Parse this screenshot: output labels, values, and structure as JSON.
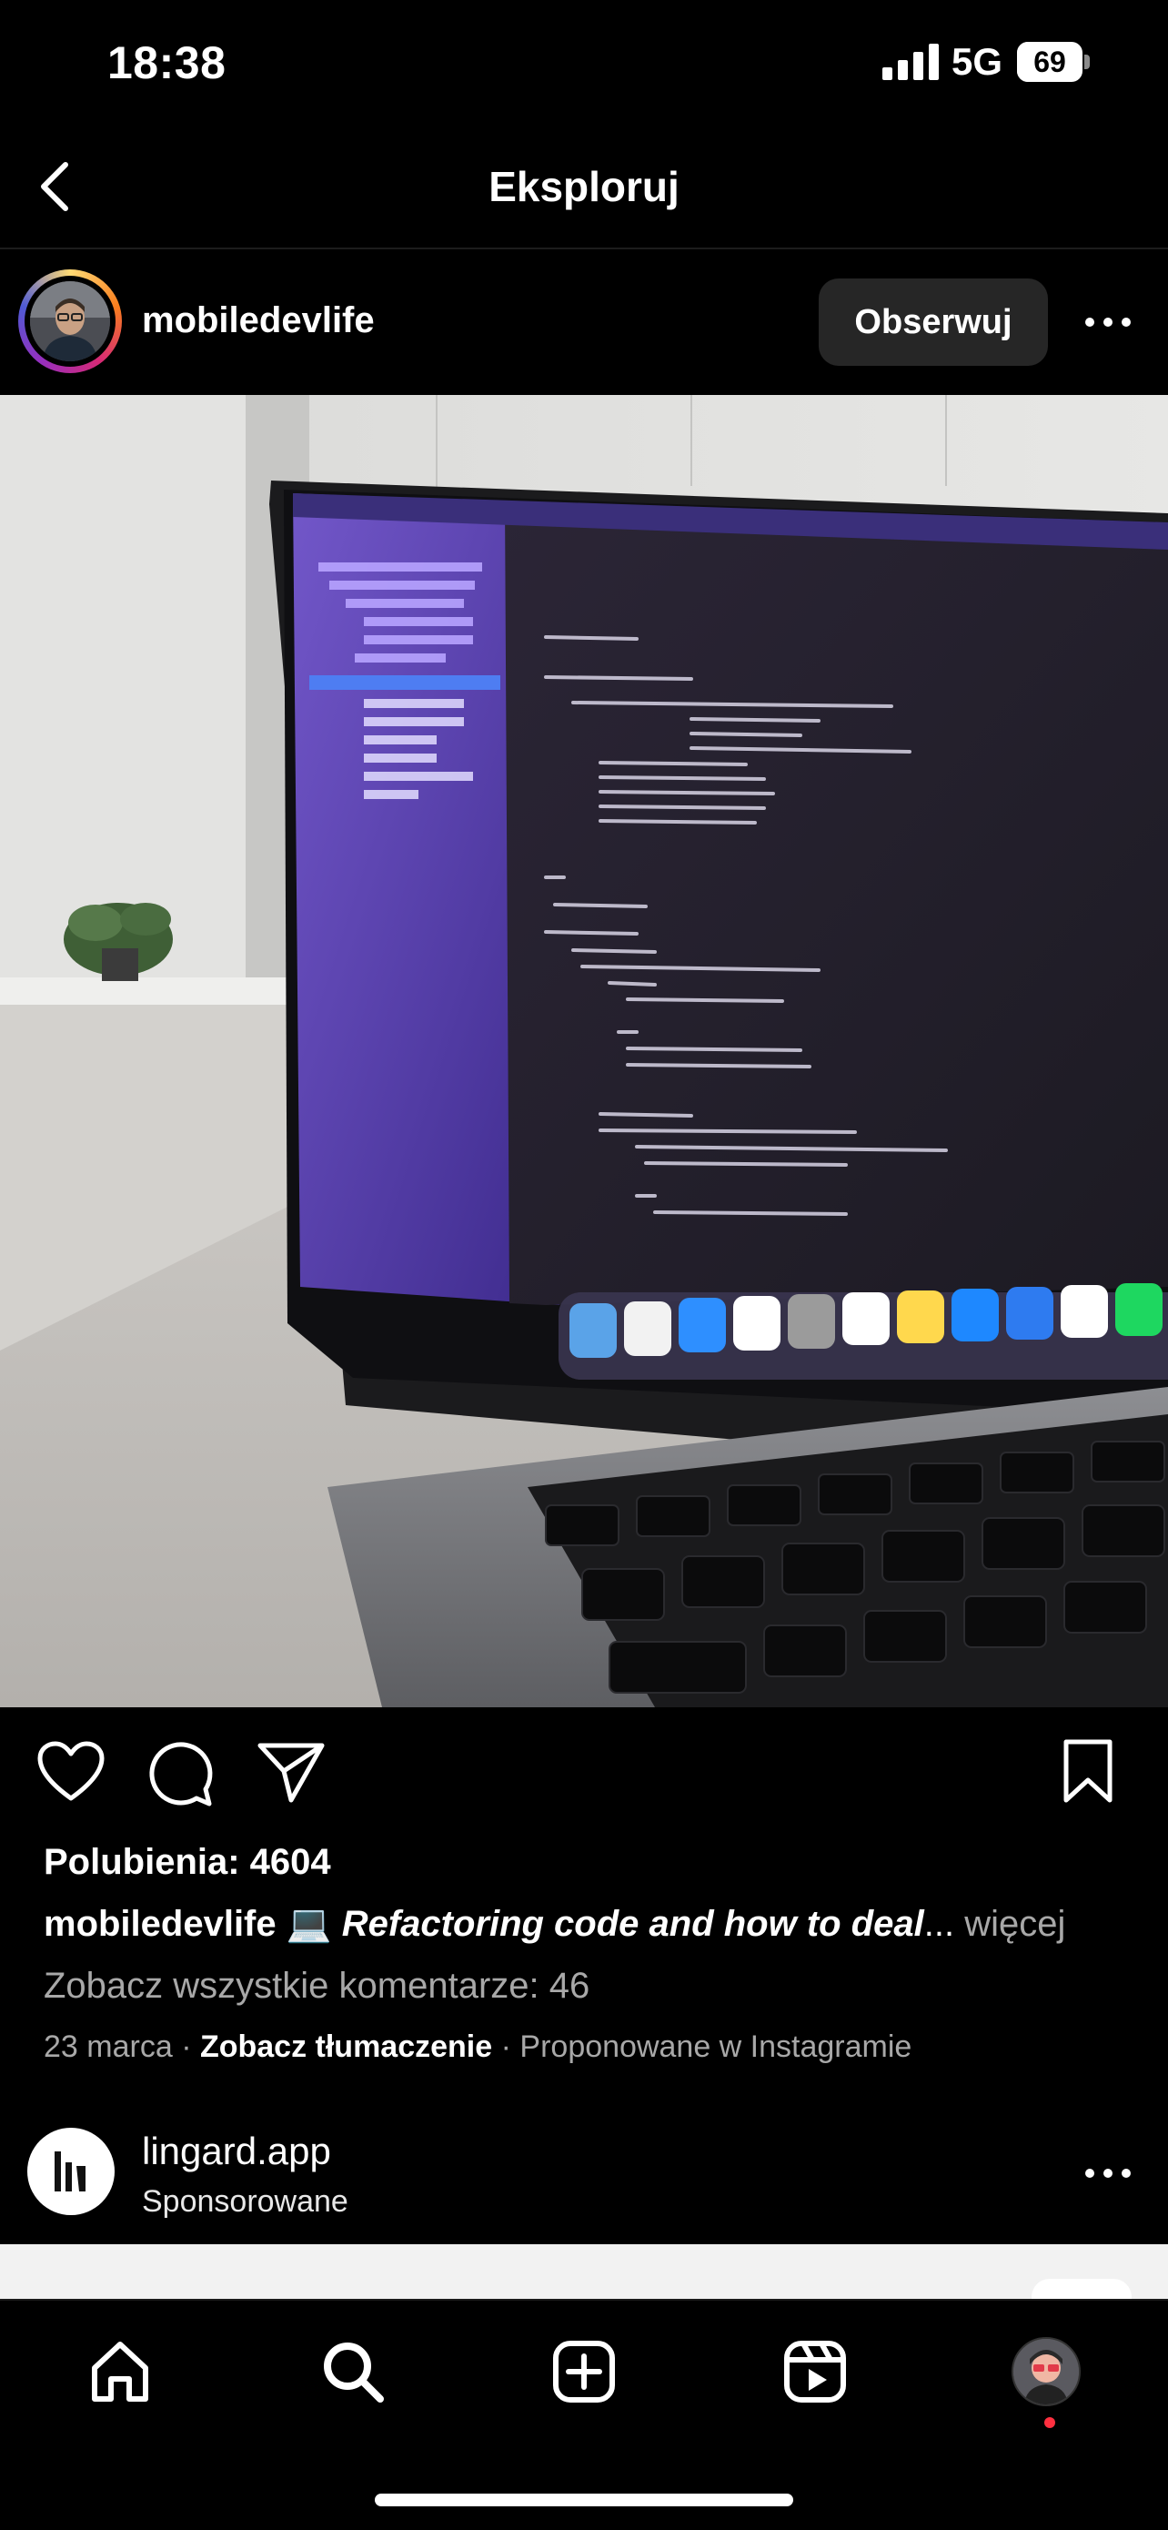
{
  "status_bar": {
    "time": "18:38",
    "network": "5G",
    "battery": "69",
    "battery_level": 0.69
  },
  "header": {
    "title": "Eksploruj"
  },
  "post": {
    "username": "mobiledevlife",
    "follow_label": "Obserwuj",
    "likes": "Polubienia: 4604",
    "caption_username": "mobiledevlife",
    "caption_emoji": "💻",
    "caption_text": "Refactoring code and how to deal",
    "caption_ellipsis": "...",
    "caption_more": "więcej",
    "view_comments": "Zobacz wszystkie komentarze: 46",
    "date": "23 marca",
    "separator": "·",
    "translate": "Zobacz tłumaczenie",
    "suggested": "Proponowane w Instagramie"
  },
  "sponsored": {
    "name": "lingard.app",
    "label": "Sponsorowane"
  },
  "colors": {
    "background": "#000000",
    "secondary_text": "#a8a8a8",
    "button_bg": "#262626",
    "notification": "#ff3040"
  },
  "icons": [
    "back-icon",
    "more-icon",
    "heart-icon",
    "comment-icon",
    "send-icon",
    "bookmark-icon",
    "home-icon",
    "search-icon",
    "create-icon",
    "reels-icon",
    "profile-icon"
  ]
}
